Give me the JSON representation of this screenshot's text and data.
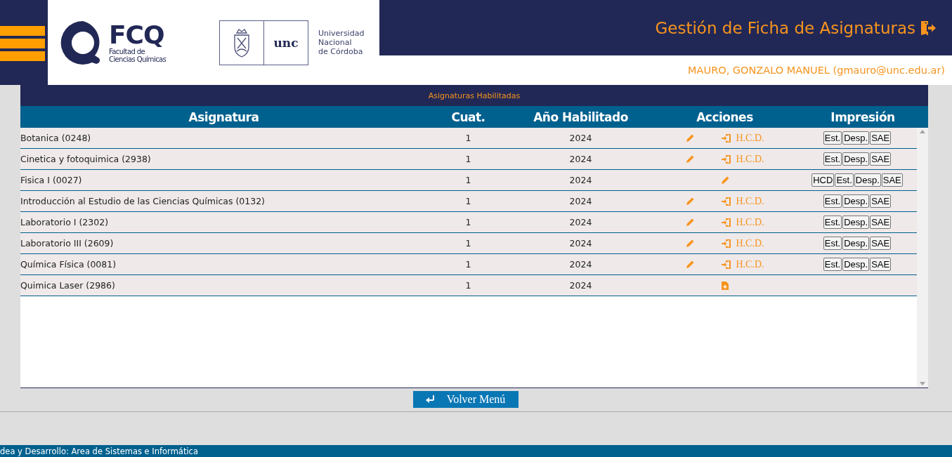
{
  "header": {
    "fcq_logo": {
      "mark": "FCQ",
      "lines": [
        "Facultad de",
        "Ciencias Químicas"
      ]
    },
    "unc_logo": {
      "mark": "unc",
      "lines": [
        "Universidad",
        "Nacional",
        "de Córdoba"
      ]
    },
    "title": "Gestión de Ficha de Asignaturas",
    "user": "MAURO, GONZALO MANUEL (gmauro@unc.edu.ar)"
  },
  "table": {
    "caption": "Asignaturas Habilitadas",
    "columns": [
      "Asignatura",
      "Cuat.",
      "Año Habilitado",
      "Acciones",
      "Impresión"
    ],
    "rows": [
      {
        "name": "Botanica (0248)",
        "cuat": "1",
        "year": "2024",
        "actions": [
          {
            "kind": "edit"
          },
          {
            "kind": "hcd",
            "label": "H.C.D."
          }
        ],
        "prints": [
          "Est.",
          "Desp.",
          "SAE"
        ]
      },
      {
        "name": "Cinetica y fotoquimica (2938)",
        "cuat": "1",
        "year": "2024",
        "actions": [
          {
            "kind": "edit"
          },
          {
            "kind": "hcd",
            "label": "H.C.D."
          }
        ],
        "prints": [
          "Est.",
          "Desp.",
          "SAE"
        ]
      },
      {
        "name": "Fisica I (0027)",
        "cuat": "1",
        "year": "2024",
        "actions": [
          {
            "kind": "edit"
          }
        ],
        "prints": [
          "HCD",
          "Est.",
          "Desp.",
          "SAE"
        ]
      },
      {
        "name": "Introducción al Estudio de las Ciencias Químicas (0132)",
        "cuat": "1",
        "year": "2024",
        "actions": [
          {
            "kind": "edit"
          },
          {
            "kind": "hcd",
            "label": "H.C.D."
          }
        ],
        "prints": [
          "Est.",
          "Desp.",
          "SAE"
        ]
      },
      {
        "name": "Laboratorio I (2302)",
        "cuat": "1",
        "year": "2024",
        "actions": [
          {
            "kind": "edit"
          },
          {
            "kind": "hcd",
            "label": "H.C.D."
          }
        ],
        "prints": [
          "Est.",
          "Desp.",
          "SAE"
        ]
      },
      {
        "name": "Laboratorio III (2609)",
        "cuat": "1",
        "year": "2024",
        "actions": [
          {
            "kind": "edit"
          },
          {
            "kind": "hcd",
            "label": "H.C.D."
          }
        ],
        "prints": [
          "Est.",
          "Desp.",
          "SAE"
        ]
      },
      {
        "name": "Química Física (0081)",
        "cuat": "1",
        "year": "2024",
        "actions": [
          {
            "kind": "edit"
          },
          {
            "kind": "hcd",
            "label": "H.C.D."
          }
        ],
        "prints": [
          "Est.",
          "Desp.",
          "SAE"
        ]
      },
      {
        "name": "Quimica Laser (2986)",
        "cuat": "1",
        "year": "2024",
        "actions": [
          {
            "kind": "new-file"
          }
        ],
        "prints": []
      }
    ]
  },
  "back_button": "Volver Menú",
  "footer": "dea y Desarrollo: Area de Sistemas e Informática"
}
